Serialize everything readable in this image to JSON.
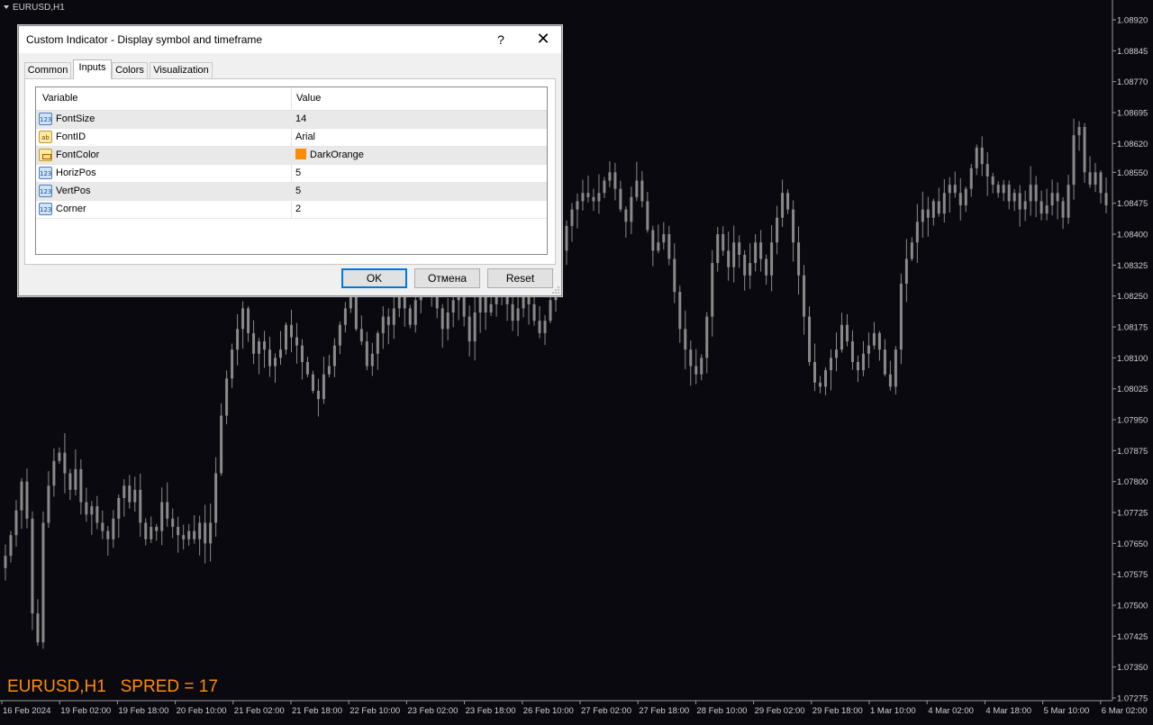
{
  "chart": {
    "symbol_label": "EURUSD,H1",
    "overlay_text": "EURUSD,H1   SPRED = 17",
    "overlay_color": "#ff8c00",
    "candle_color": "#8a8a8a",
    "background": "#0a090f",
    "price_ticks": [
      "1.08920",
      "1.08845",
      "1.08770",
      "1.08695",
      "1.08620",
      "1.08550",
      "1.08475",
      "1.08400",
      "1.08325",
      "1.08250",
      "1.08175",
      "1.08100",
      "1.08025",
      "1.07950",
      "1.07875",
      "1.07800",
      "1.07725",
      "1.07650",
      "1.07575",
      "1.07500",
      "1.07425",
      "1.07350",
      "1.07275"
    ],
    "time_ticks": [
      "16 Feb 2024",
      "19 Feb 02:00",
      "19 Feb 18:00",
      "20 Feb 10:00",
      "21 Feb 02:00",
      "21 Feb 18:00",
      "22 Feb 10:00",
      "23 Feb 02:00",
      "23 Feb 18:00",
      "26 Feb 10:00",
      "27 Feb 02:00",
      "27 Feb 18:00",
      "28 Feb 10:00",
      "29 Feb 02:00",
      "29 Feb 18:00",
      "1 Mar 10:00",
      "4 Mar 02:00",
      "4 Mar 18:00",
      "5 Mar 10:00",
      "6 Mar 02:00"
    ],
    "closes": [
      1.0762,
      1.0767,
      1.0773,
      1.078,
      1.0771,
      1.0748,
      1.0741,
      1.077,
      1.0779,
      1.0785,
      1.0787,
      1.0782,
      1.0778,
      1.0783,
      1.0775,
      1.0772,
      1.0774,
      1.077,
      1.0768,
      1.0766,
      1.0771,
      1.0776,
      1.0779,
      1.0775,
      1.0778,
      1.077,
      1.0766,
      1.0769,
      1.0768,
      1.0775,
      1.0771,
      1.0769,
      1.0767,
      1.0766,
      1.0768,
      1.0766,
      1.077,
      1.0765,
      1.077,
      1.0782,
      1.0796,
      1.0805,
      1.0812,
      1.0817,
      1.0822,
      1.0816,
      1.0811,
      1.0814,
      1.0812,
      1.0808,
      1.081,
      1.0812,
      1.0818,
      1.0815,
      1.0813,
      1.0809,
      1.0806,
      1.0802,
      1.08,
      1.0806,
      1.0808,
      1.0813,
      1.0818,
      1.0822,
      1.0825,
      1.0817,
      1.0814,
      1.0808,
      1.0811,
      1.0816,
      1.082,
      1.0818,
      1.0822,
      1.0826,
      1.0822,
      1.0818,
      1.0824,
      1.0829,
      1.0831,
      1.0827,
      1.0822,
      1.0817,
      1.0821,
      1.0824,
      1.0826,
      1.082,
      1.0814,
      1.0821,
      1.0825,
      1.0821,
      1.0823,
      1.0825,
      1.0827,
      1.0823,
      1.0819,
      1.0822,
      1.0825,
      1.0823,
      1.0819,
      1.0816,
      1.0819,
      1.0824,
      1.083,
      1.0836,
      1.0842,
      1.0846,
      1.0848,
      1.085,
      1.0849,
      1.0848,
      1.085,
      1.0853,
      1.0855,
      1.0851,
      1.0846,
      1.0843,
      1.0849,
      1.0853,
      1.0848,
      1.0841,
      1.0836,
      1.0838,
      1.084,
      1.0834,
      1.0826,
      1.0817,
      1.0812,
      1.0808,
      1.0806,
      1.081,
      1.082,
      1.0833,
      1.084,
      1.0836,
      1.0832,
      1.0838,
      1.0835,
      1.083,
      1.0833,
      1.0838,
      1.0834,
      1.083,
      1.0838,
      1.0844,
      1.085,
      1.0846,
      1.0838,
      1.083,
      1.082,
      1.0809,
      1.0804,
      1.0803,
      1.0807,
      1.081,
      1.0812,
      1.0818,
      1.0814,
      1.0809,
      1.0807,
      1.0811,
      1.0813,
      1.0816,
      1.0812,
      1.0806,
      1.0803,
      1.0812,
      1.0828,
      1.0834,
      1.0838,
      1.0843,
      1.0846,
      1.0844,
      1.0848,
      1.0845,
      1.085,
      1.0852,
      1.085,
      1.0847,
      1.0851,
      1.0856,
      1.0861,
      1.0857,
      1.0854,
      1.0852,
      1.085,
      1.0852,
      1.0848,
      1.085,
      1.0846,
      1.0848,
      1.0852,
      1.0848,
      1.0845,
      1.0847,
      1.085,
      1.0848,
      1.0844,
      1.0852,
      1.0864,
      1.0866,
      1.0855,
      1.0852,
      1.0855,
      1.085,
      1.0847
    ]
  },
  "dialog": {
    "title": "Custom Indicator - Display symbol and timeframe",
    "help_label": "?",
    "close_label": "✕",
    "tabs": [
      "Common",
      "Inputs",
      "Colors",
      "Visualization"
    ],
    "columns": [
      "Variable",
      "Value"
    ],
    "rows": [
      {
        "icon": "123",
        "name": "FontSize",
        "value": "14"
      },
      {
        "icon": "ab",
        "name": "FontID",
        "value": "Arial"
      },
      {
        "icon": "color-icon",
        "name": "FontColor",
        "value": "DarkOrange",
        "swatch": "#ff8c00"
      },
      {
        "icon": "123",
        "name": "HorizPos",
        "value": "5"
      },
      {
        "icon": "123",
        "name": "VertPos",
        "value": "5"
      },
      {
        "icon": "123",
        "name": "Corner",
        "value": "2"
      }
    ],
    "buttons": {
      "ok": "OK",
      "cancel": "Отмена",
      "reset": "Reset"
    }
  }
}
